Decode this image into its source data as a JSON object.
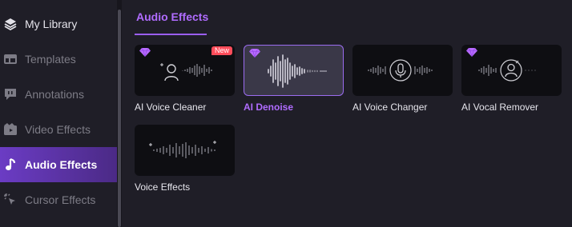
{
  "sidebar": {
    "items": [
      {
        "label": "My Library",
        "icon": "layers-icon"
      },
      {
        "label": "Templates",
        "icon": "templates-icon"
      },
      {
        "label": "Annotations",
        "icon": "annotation-icon"
      },
      {
        "label": "Video Effects",
        "icon": "video-effects-icon"
      },
      {
        "label": "Audio Effects",
        "icon": "music-note-icon",
        "active": true
      },
      {
        "label": "Cursor Effects",
        "icon": "cursor-click-icon"
      }
    ]
  },
  "main": {
    "tab_label": "Audio Effects",
    "cards": [
      {
        "label": "AI Voice Cleaner",
        "premium": true,
        "badge": "New",
        "icon": "voice-cleaner-icon"
      },
      {
        "label": "AI Denoise",
        "premium": true,
        "selected": true,
        "icon": "denoise-waveform-icon"
      },
      {
        "label": "AI Voice Changer",
        "premium": false,
        "icon": "microphone-icon"
      },
      {
        "label": "AI Vocal Remover",
        "premium": true,
        "icon": "vocal-remover-icon"
      },
      {
        "label": "Voice Effects",
        "premium": false,
        "icon": "sparkle-waveform-icon"
      }
    ]
  },
  "colors": {
    "accent": "#9b5ef3",
    "active_nav": "#6b3cc4",
    "new_badge": "#ff4d5b",
    "premium_gem": "#b86cff"
  }
}
